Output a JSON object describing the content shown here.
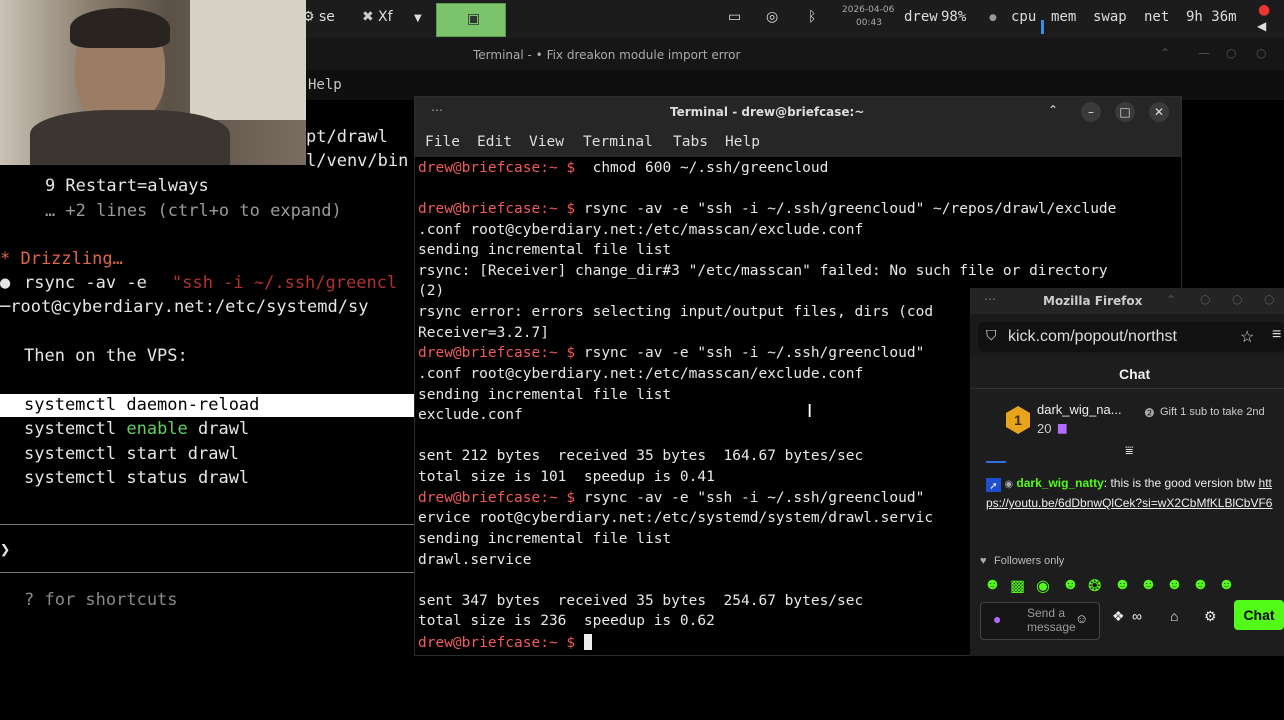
{
  "topbar": {
    "task1": "se",
    "task2": "Xf",
    "date": "2026-04-06",
    "time": "00:43",
    "user": "drew",
    "battery": "98%",
    "cpu": "cpu",
    "mem": "mem",
    "swap": "swap",
    "net": "net",
    "uptime": "9h 36m"
  },
  "bg_window": {
    "title": "Terminal - • Fix dreakon module import error",
    "menu_help": "Help"
  },
  "left_pane": {
    "path1": "pt/drawl",
    "path2": "l/venv/bin",
    "l_restart": "    9 Restart=always",
    "l_more": "    … +2 lines (ctrl+o to expand)",
    "l_drizzling": "* Drizzling…",
    "l_bullet": "●",
    "l_rsync_cmd": "rsync -av -e ",
    "l_rsync_arg": "\"ssh -i ~/.ssh/greencl",
    "l_root": "root@cyberdiary.net:/etc/systemd/sy",
    "l_then": "Then on the VPS:",
    "cmd1": "systemctl daemon-reload",
    "cmd2_a": "systemctl ",
    "cmd2_b": "enable",
    "cmd2_c": " drawl",
    "cmd3": "systemctl start drawl",
    "cmd4": "systemctl status drawl",
    "l_gt": "❯",
    "l_shortcuts": "? for shortcuts"
  },
  "terminal": {
    "title": "Terminal - drew@briefcase:~",
    "menu": [
      "File",
      "Edit",
      "View",
      "Terminal",
      "Tabs",
      "Help"
    ],
    "prompt": "drew@briefcase:~ $",
    "lines": {
      "c1": "  chmod 600 ~/.ssh/greencloud",
      "c2": " rsync -av -e \"ssh -i ~/.ssh/greencloud\" ~/repos/drawl/exclude",
      "o2a": ".conf root@cyberdiary.net:/etc/masscan/exclude.conf",
      "o2b": "sending incremental file list",
      "o2c": "rsync: [Receiver] change_dir#3 \"/etc/masscan\" failed: No such file or directory",
      "o2d": "(2)",
      "o2e": "rsync error: errors selecting input/output files, dirs (cod",
      "o2f": "Receiver=3.2.7]",
      "c3": " rsync -av -e \"ssh -i ~/.ssh/greencloud\"",
      "o3a": ".conf root@cyberdiary.net:/etc/masscan/exclude.conf",
      "o3b": "sending incremental file list",
      "o3c": "exclude.conf",
      "o3d": "sent 212 bytes  received 35 bytes  164.67 bytes/sec",
      "o3e": "total size is 101  speedup is 0.41",
      "c4": " rsync -av -e \"ssh -i ~/.ssh/greencloud\"",
      "o4a": "ervice root@cyberdiary.net:/etc/systemd/system/drawl.servic",
      "o4b": "sending incremental file list",
      "o4c": "drawl.service",
      "o4d": "sent 347 bytes  received 35 bytes  254.67 bytes/sec",
      "o4e": "total size is 236  speedup is 0.62"
    }
  },
  "firefox": {
    "title": "Mozilla Firefox",
    "url": "kick.com/popout/northst",
    "chat_header": "Chat",
    "gifter_rank": "1",
    "gifter_name": "dark_wig_na...",
    "gifter_count": "20",
    "gift_cta": "Gift 1 sub to take 2nd",
    "msg_user": "dark_wig_natty",
    "msg_text": ": this is the good version btw ",
    "msg_link": "https://youtu.be/6dDbnwQlCek?si=wX2CbMfKLBlCbVF6",
    "followers_only": "Followers only",
    "send_placeholder": "Send a message",
    "chat_button": "Chat",
    "colors": {
      "kick_green": "#53fc18",
      "kick_user": "#53fc18"
    }
  }
}
